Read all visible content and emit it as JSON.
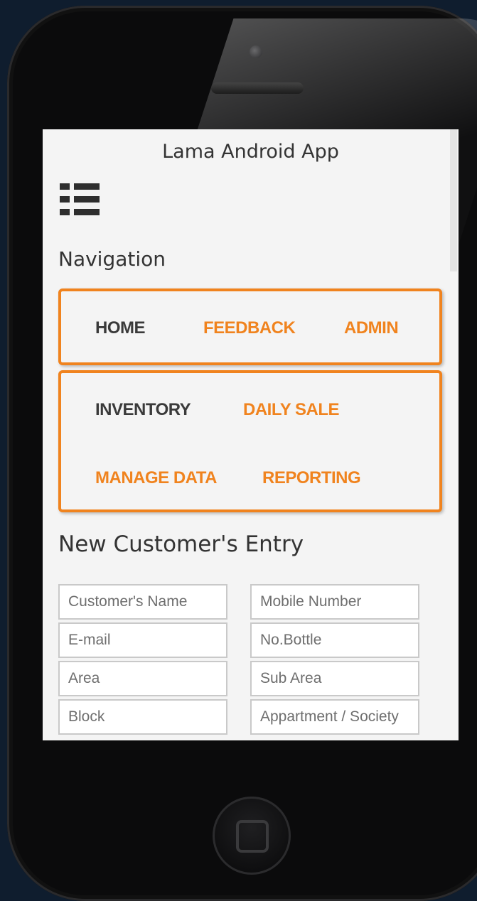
{
  "app": {
    "title": "Lama Android App"
  },
  "navigation": {
    "heading": "Navigation",
    "row1": [
      {
        "label": "HOME",
        "color": "#3a3a3a"
      },
      {
        "label": "FEEDBACK",
        "color": "#f0831e"
      },
      {
        "label": "ADMIN",
        "color": "#f0831e"
      }
    ],
    "row2": [
      {
        "label": "INVENTORY",
        "color": "#3a3a3a"
      },
      {
        "label": "DAILY SALE",
        "color": "#f0831e"
      },
      {
        "label": "MANAGE DATA",
        "color": "#f0831e"
      },
      {
        "label": "REPORTING",
        "color": "#f0831e"
      }
    ]
  },
  "form": {
    "heading": "New Customer's Entry",
    "fields": {
      "customer_name": {
        "placeholder": "Customer's Name"
      },
      "mobile_number": {
        "placeholder": "Mobile Number"
      },
      "email": {
        "placeholder": "E-mail"
      },
      "no_bottle": {
        "placeholder": "No.Bottle"
      },
      "area": {
        "placeholder": "Area"
      },
      "sub_area": {
        "placeholder": "Sub Area"
      },
      "block": {
        "placeholder": "Block"
      },
      "appartment": {
        "placeholder": "Appartment / Society"
      }
    }
  },
  "theme": {
    "accent": "#f0831e",
    "screen_bg": "#f4f4f4",
    "phone_body": "#0b0b0c"
  },
  "icons": [
    "menu-list-icon"
  ]
}
